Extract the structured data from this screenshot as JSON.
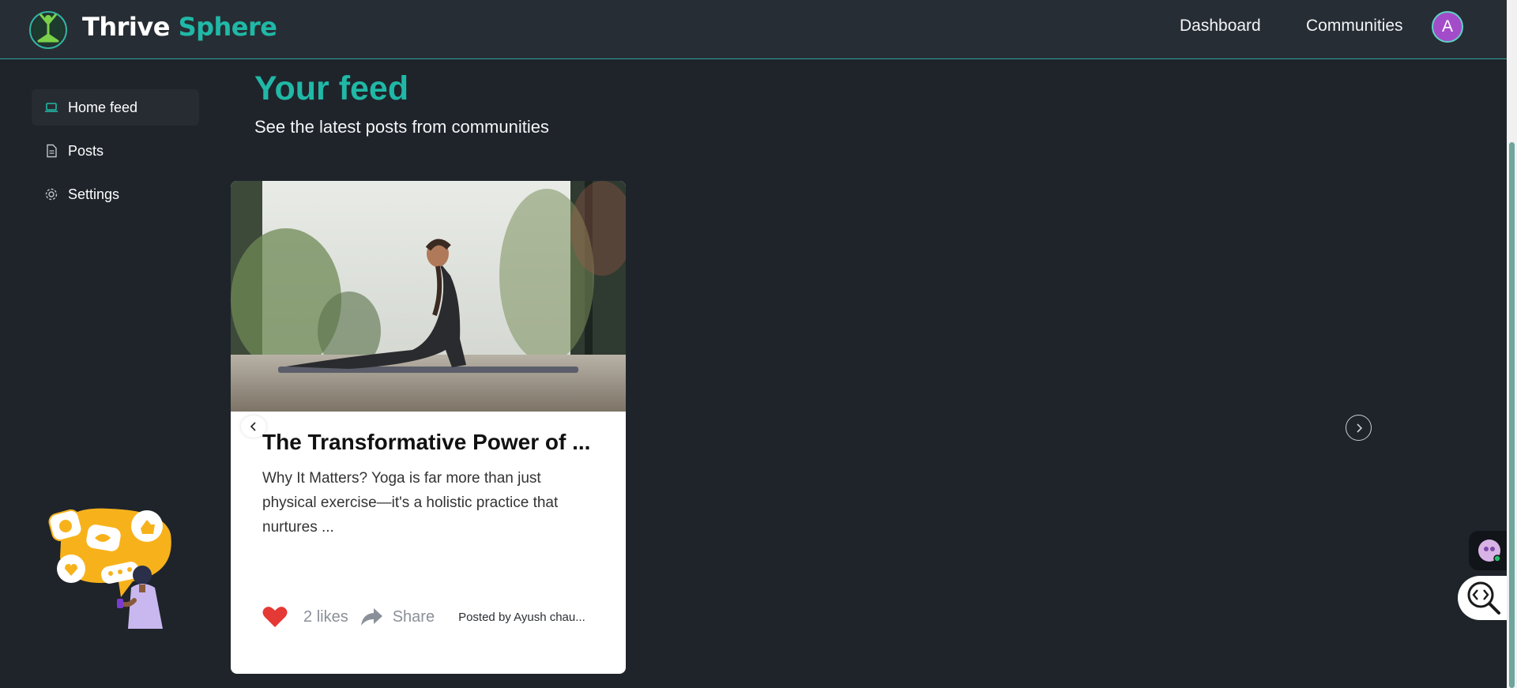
{
  "header": {
    "brand_part1": "Thrive",
    "brand_part2": "Sphere",
    "nav": {
      "dashboard": "Dashboard",
      "communities": "Communities"
    },
    "avatar_initial": "A"
  },
  "sidebar": {
    "items": [
      {
        "label": "Home feed",
        "icon": "laptop-icon",
        "active": true
      },
      {
        "label": "Posts",
        "icon": "document-icon",
        "active": false
      },
      {
        "label": "Settings",
        "icon": "gear-icon",
        "active": false
      }
    ]
  },
  "main": {
    "title": "Your feed",
    "subtitle": "See the latest posts from communities"
  },
  "posts": [
    {
      "title": "The Transformative Power of ...",
      "excerpt": "Why It Matters? Yoga is far more than just physical exercise—it's a holistic practice that nurtures ...",
      "likes_count": "2",
      "likes_label": "likes",
      "share_label": "Share",
      "posted_by": "Posted by Ayush chau..."
    }
  ],
  "colors": {
    "accent": "#20b8a6",
    "background": "#1f242b",
    "header": "#272d34",
    "avatar": "#a34cc9",
    "like": "#e53935"
  }
}
